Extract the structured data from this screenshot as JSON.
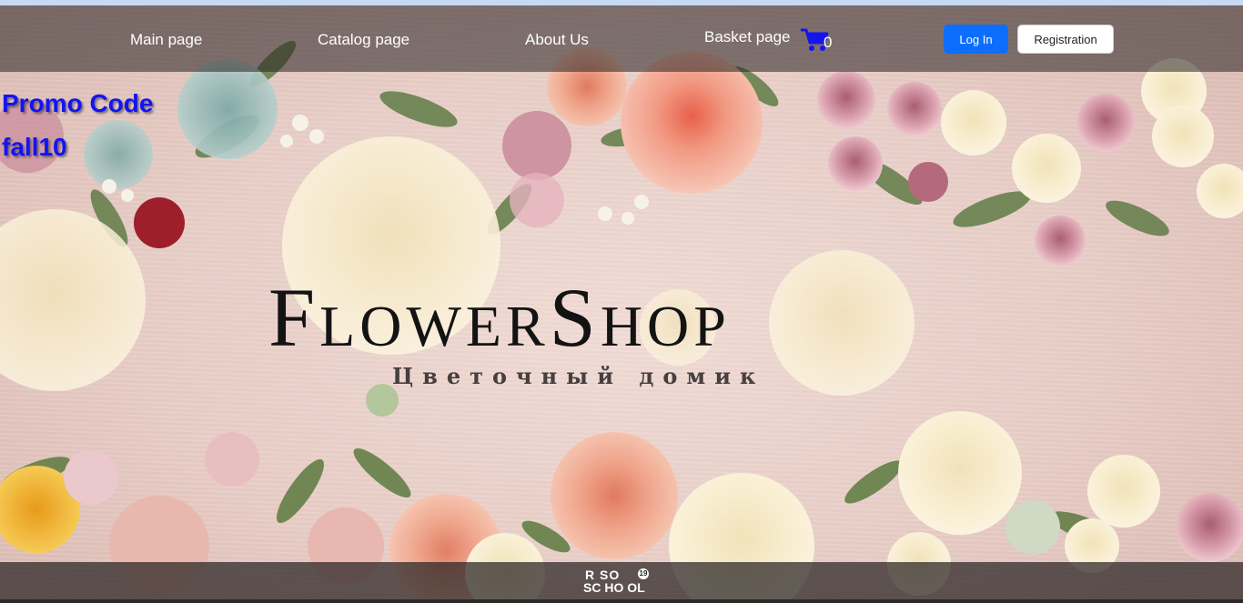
{
  "nav": {
    "links": [
      {
        "label": "Main page"
      },
      {
        "label": "Catalog page"
      },
      {
        "label": "About Us"
      },
      {
        "label": "Basket page"
      }
    ],
    "cart_count": "0",
    "login_label": "Log In",
    "registration_label": "Registration"
  },
  "promo": {
    "line1": "Promo Code",
    "line2": "fall10"
  },
  "logo": {
    "title": "FlowerShop",
    "subtitle": "Цветочный домик"
  },
  "footer": {
    "school_line1": "R SO",
    "school_line2": "SC HO OL",
    "school_badge": "19"
  },
  "colors": {
    "accent": "#0d6efd",
    "promo_text": "#1414f0",
    "cart_icon": "#1414f0",
    "nav_overlay": "#282222"
  },
  "icons": {
    "cart": "shopping-cart-icon"
  }
}
